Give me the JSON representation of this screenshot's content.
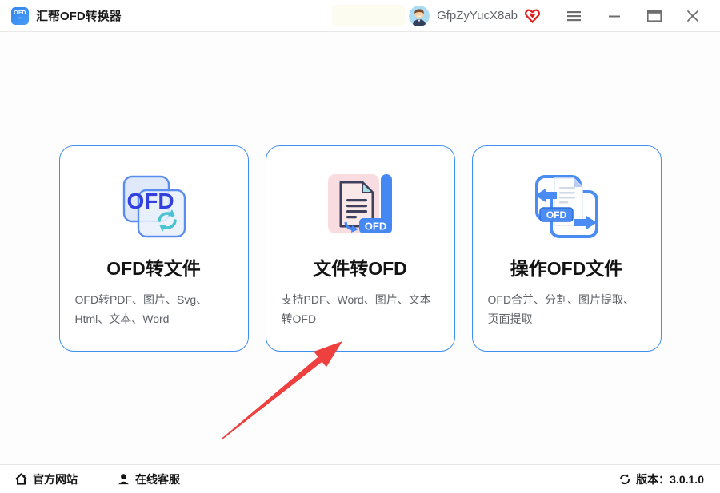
{
  "titlebar": {
    "app_title": "汇帮OFD转换器",
    "app_icon_text": "OFD",
    "username": "GfpZyYucX8ab"
  },
  "cards": [
    {
      "title": "OFD转文件",
      "desc": "OFD转PDF、图片、Svg、Html、文本、Word",
      "icon_label": "OFD"
    },
    {
      "title": "文件转OFD",
      "desc": "支持PDF、Word、图片、文本转OFD",
      "icon_label": "OFD"
    },
    {
      "title": "操作OFD文件",
      "desc": "OFD合并、分割、图片提取、页面提取",
      "icon_label": "OFD"
    }
  ],
  "footer": {
    "website_label": "官方网站",
    "support_label": "在线客服",
    "version_label": "版本：3.0.1.0"
  },
  "colors": {
    "accent_blue": "#3f8ff2",
    "icon_blue": "#4588f4",
    "ofd_text_blue": "#3240e0",
    "teal": "#49c3cf",
    "arrow_red": "#ef4040",
    "vip_red": "#e11d1d"
  }
}
